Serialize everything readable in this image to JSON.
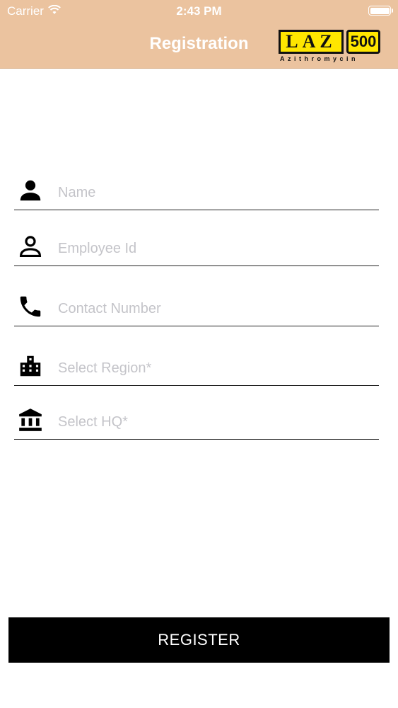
{
  "status_bar": {
    "carrier": "Carrier",
    "time": "2:43 PM"
  },
  "header": {
    "title": "Registration",
    "background": "#ebc39f"
  },
  "logo": {
    "brand": "LAZ",
    "dose": "500",
    "subtitle": "Azithromycin"
  },
  "form": {
    "name_placeholder": "Name",
    "employee_id_placeholder": "Employee Id",
    "contact_placeholder": "Contact Number",
    "region_placeholder": "Select Region*",
    "hq_placeholder": "Select HQ*",
    "icons": [
      "person-icon",
      "person-outline-icon",
      "phone-icon",
      "city-icon",
      "bank-icon"
    ]
  },
  "register_button": {
    "label": "REGISTER"
  }
}
